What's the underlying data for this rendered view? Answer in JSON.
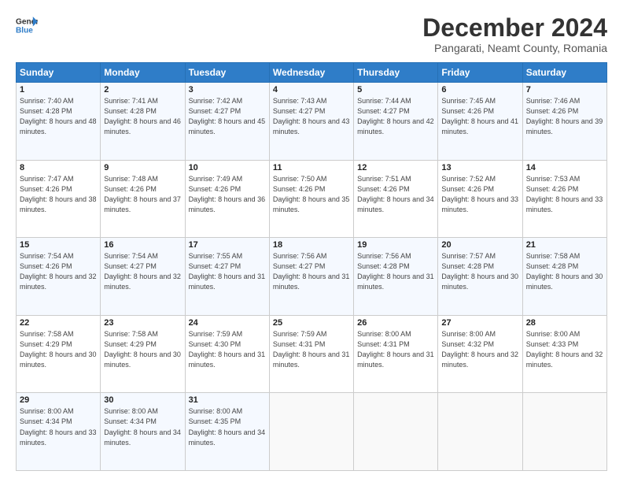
{
  "logo": {
    "line1": "General",
    "line2": "Blue"
  },
  "title": "December 2024",
  "subtitle": "Pangarati, Neamt County, Romania",
  "header_days": [
    "Sunday",
    "Monday",
    "Tuesday",
    "Wednesday",
    "Thursday",
    "Friday",
    "Saturday"
  ],
  "weeks": [
    [
      {
        "day": "1",
        "sunrise": "Sunrise: 7:40 AM",
        "sunset": "Sunset: 4:28 PM",
        "daylight": "Daylight: 8 hours and 48 minutes."
      },
      {
        "day": "2",
        "sunrise": "Sunrise: 7:41 AM",
        "sunset": "Sunset: 4:28 PM",
        "daylight": "Daylight: 8 hours and 46 minutes."
      },
      {
        "day": "3",
        "sunrise": "Sunrise: 7:42 AM",
        "sunset": "Sunset: 4:27 PM",
        "daylight": "Daylight: 8 hours and 45 minutes."
      },
      {
        "day": "4",
        "sunrise": "Sunrise: 7:43 AM",
        "sunset": "Sunset: 4:27 PM",
        "daylight": "Daylight: 8 hours and 43 minutes."
      },
      {
        "day": "5",
        "sunrise": "Sunrise: 7:44 AM",
        "sunset": "Sunset: 4:27 PM",
        "daylight": "Daylight: 8 hours and 42 minutes."
      },
      {
        "day": "6",
        "sunrise": "Sunrise: 7:45 AM",
        "sunset": "Sunset: 4:26 PM",
        "daylight": "Daylight: 8 hours and 41 minutes."
      },
      {
        "day": "7",
        "sunrise": "Sunrise: 7:46 AM",
        "sunset": "Sunset: 4:26 PM",
        "daylight": "Daylight: 8 hours and 39 minutes."
      }
    ],
    [
      {
        "day": "8",
        "sunrise": "Sunrise: 7:47 AM",
        "sunset": "Sunset: 4:26 PM",
        "daylight": "Daylight: 8 hours and 38 minutes."
      },
      {
        "day": "9",
        "sunrise": "Sunrise: 7:48 AM",
        "sunset": "Sunset: 4:26 PM",
        "daylight": "Daylight: 8 hours and 37 minutes."
      },
      {
        "day": "10",
        "sunrise": "Sunrise: 7:49 AM",
        "sunset": "Sunset: 4:26 PM",
        "daylight": "Daylight: 8 hours and 36 minutes."
      },
      {
        "day": "11",
        "sunrise": "Sunrise: 7:50 AM",
        "sunset": "Sunset: 4:26 PM",
        "daylight": "Daylight: 8 hours and 35 minutes."
      },
      {
        "day": "12",
        "sunrise": "Sunrise: 7:51 AM",
        "sunset": "Sunset: 4:26 PM",
        "daylight": "Daylight: 8 hours and 34 minutes."
      },
      {
        "day": "13",
        "sunrise": "Sunrise: 7:52 AM",
        "sunset": "Sunset: 4:26 PM",
        "daylight": "Daylight: 8 hours and 33 minutes."
      },
      {
        "day": "14",
        "sunrise": "Sunrise: 7:53 AM",
        "sunset": "Sunset: 4:26 PM",
        "daylight": "Daylight: 8 hours and 33 minutes."
      }
    ],
    [
      {
        "day": "15",
        "sunrise": "Sunrise: 7:54 AM",
        "sunset": "Sunset: 4:26 PM",
        "daylight": "Daylight: 8 hours and 32 minutes."
      },
      {
        "day": "16",
        "sunrise": "Sunrise: 7:54 AM",
        "sunset": "Sunset: 4:27 PM",
        "daylight": "Daylight: 8 hours and 32 minutes."
      },
      {
        "day": "17",
        "sunrise": "Sunrise: 7:55 AM",
        "sunset": "Sunset: 4:27 PM",
        "daylight": "Daylight: 8 hours and 31 minutes."
      },
      {
        "day": "18",
        "sunrise": "Sunrise: 7:56 AM",
        "sunset": "Sunset: 4:27 PM",
        "daylight": "Daylight: 8 hours and 31 minutes."
      },
      {
        "day": "19",
        "sunrise": "Sunrise: 7:56 AM",
        "sunset": "Sunset: 4:28 PM",
        "daylight": "Daylight: 8 hours and 31 minutes."
      },
      {
        "day": "20",
        "sunrise": "Sunrise: 7:57 AM",
        "sunset": "Sunset: 4:28 PM",
        "daylight": "Daylight: 8 hours and 30 minutes."
      },
      {
        "day": "21",
        "sunrise": "Sunrise: 7:58 AM",
        "sunset": "Sunset: 4:28 PM",
        "daylight": "Daylight: 8 hours and 30 minutes."
      }
    ],
    [
      {
        "day": "22",
        "sunrise": "Sunrise: 7:58 AM",
        "sunset": "Sunset: 4:29 PM",
        "daylight": "Daylight: 8 hours and 30 minutes."
      },
      {
        "day": "23",
        "sunrise": "Sunrise: 7:58 AM",
        "sunset": "Sunset: 4:29 PM",
        "daylight": "Daylight: 8 hours and 30 minutes."
      },
      {
        "day": "24",
        "sunrise": "Sunrise: 7:59 AM",
        "sunset": "Sunset: 4:30 PM",
        "daylight": "Daylight: 8 hours and 31 minutes."
      },
      {
        "day": "25",
        "sunrise": "Sunrise: 7:59 AM",
        "sunset": "Sunset: 4:31 PM",
        "daylight": "Daylight: 8 hours and 31 minutes."
      },
      {
        "day": "26",
        "sunrise": "Sunrise: 8:00 AM",
        "sunset": "Sunset: 4:31 PM",
        "daylight": "Daylight: 8 hours and 31 minutes."
      },
      {
        "day": "27",
        "sunrise": "Sunrise: 8:00 AM",
        "sunset": "Sunset: 4:32 PM",
        "daylight": "Daylight: 8 hours and 32 minutes."
      },
      {
        "day": "28",
        "sunrise": "Sunrise: 8:00 AM",
        "sunset": "Sunset: 4:33 PM",
        "daylight": "Daylight: 8 hours and 32 minutes."
      }
    ],
    [
      {
        "day": "29",
        "sunrise": "Sunrise: 8:00 AM",
        "sunset": "Sunset: 4:34 PM",
        "daylight": "Daylight: 8 hours and 33 minutes."
      },
      {
        "day": "30",
        "sunrise": "Sunrise: 8:00 AM",
        "sunset": "Sunset: 4:34 PM",
        "daylight": "Daylight: 8 hours and 34 minutes."
      },
      {
        "day": "31",
        "sunrise": "Sunrise: 8:00 AM",
        "sunset": "Sunset: 4:35 PM",
        "daylight": "Daylight: 8 hours and 34 minutes."
      },
      null,
      null,
      null,
      null
    ]
  ]
}
